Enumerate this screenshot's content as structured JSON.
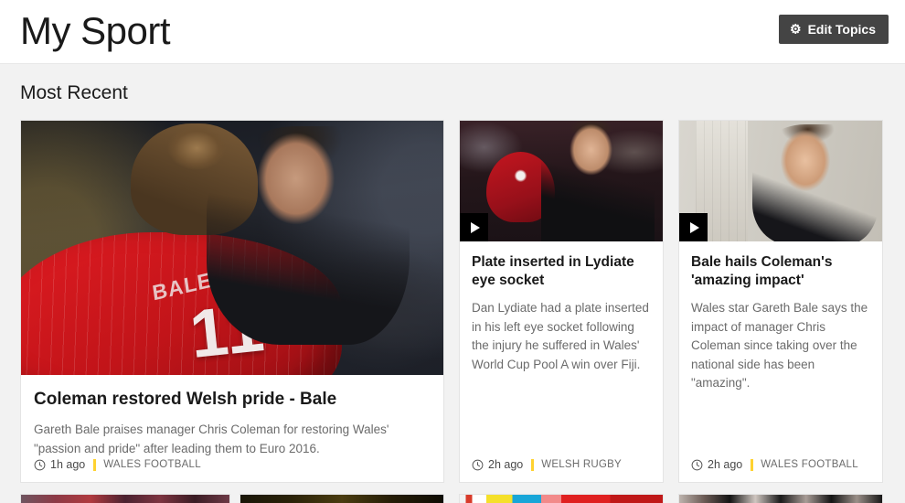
{
  "header": {
    "title": "My Sport",
    "edit_button": {
      "label": "Edit Topics",
      "icon": "gear-icon"
    }
  },
  "section": {
    "heading": "Most Recent"
  },
  "cards": [
    {
      "headline": "Coleman restored Welsh pride - Bale",
      "summary": "Gareth Bale praises manager Chris Coleman for restoring Wales' \"passion and pride\" after leading them to Euro 2016.",
      "time": "1h ago",
      "topic": "WALES FOOTBALL",
      "has_video": false,
      "image_alt": "Gareth Bale in red number 11 Wales shirt embracing manager Chris Coleman"
    },
    {
      "headline": "Plate inserted in Lydiate eye socket",
      "summary": "Dan Lydiate had a plate inserted in his left eye socket following the injury he suffered in Wales' World Cup Pool A win over Fiji.",
      "time": "2h ago",
      "topic": "WELSH RUGBY",
      "has_video": true,
      "image_alt": "Dan Lydiate holding a red Welsh international rugby cap"
    },
    {
      "headline": "Bale hails Coleman's 'amazing impact'",
      "summary": "Wales star Gareth Bale says the impact of manager Chris Coleman since taking over the national side has been \"amazing\".",
      "time": "2h ago",
      "topic": "WALES FOOTBALL",
      "has_video": true,
      "image_alt": "Gareth Bale speaking in an interview against a pale wall"
    }
  ],
  "colors": {
    "page_background": "#f2f2f2",
    "header_background": "#ffffff",
    "card_background": "#ffffff",
    "button_background": "#444444",
    "topic_divider": "#ffd230",
    "headline_text": "#1a1a1a",
    "summary_text": "#6b6b6b"
  }
}
